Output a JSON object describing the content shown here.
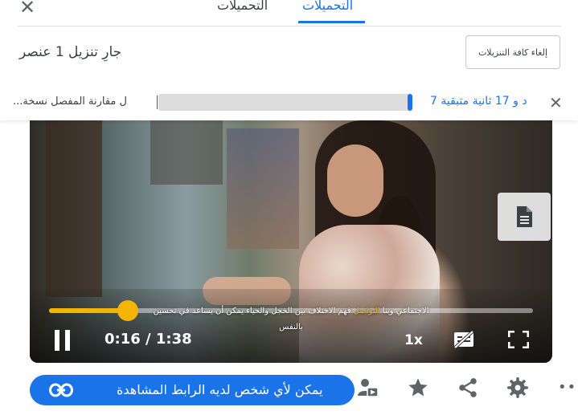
{
  "panel": {
    "close_glyph": "✕",
    "tabs": [
      {
        "label": "التحميلات",
        "active": false
      },
      {
        "label": "التحميلات",
        "active": true
      }
    ],
    "status_text": "جارِ تنزيل 1 عنصر",
    "cancel_all_label": "إلغاء كافة التنزيلات",
    "download_item": {
      "title": "...ل مقارنة المفصل نسخة",
      "progress_percent": 2,
      "remaining_text": "د و 17 ثانية متبقية 7",
      "cancel_glyph": "✕"
    }
  },
  "video": {
    "subtitle_before": "فهم الاختلاف بين الخجل والحياء يمكن أن يساعد في تحسين",
    "subtitle_highlight": "التواصل",
    "subtitle_after": "الاجتماعي وبنا",
    "subtitle_line2": "بالنفس",
    "progress_fraction": 0.163,
    "time_text": "0:16 / 1:38",
    "speed_text": "1x",
    "accent_color": "#f4b400",
    "icons": [
      "document-icon",
      "pause-icon",
      "captions-off-icon",
      "fullscreen-icon"
    ]
  },
  "action_bar": {
    "share_text": "يمكن لأي شخص لديه الرابط المشاهدة",
    "brand_color": "#1a73e8",
    "more_glyph": "•••",
    "icons": [
      "link-icon",
      "person-video-icon",
      "star-icon",
      "share-icon",
      "settings-icon",
      "more-icon"
    ]
  }
}
